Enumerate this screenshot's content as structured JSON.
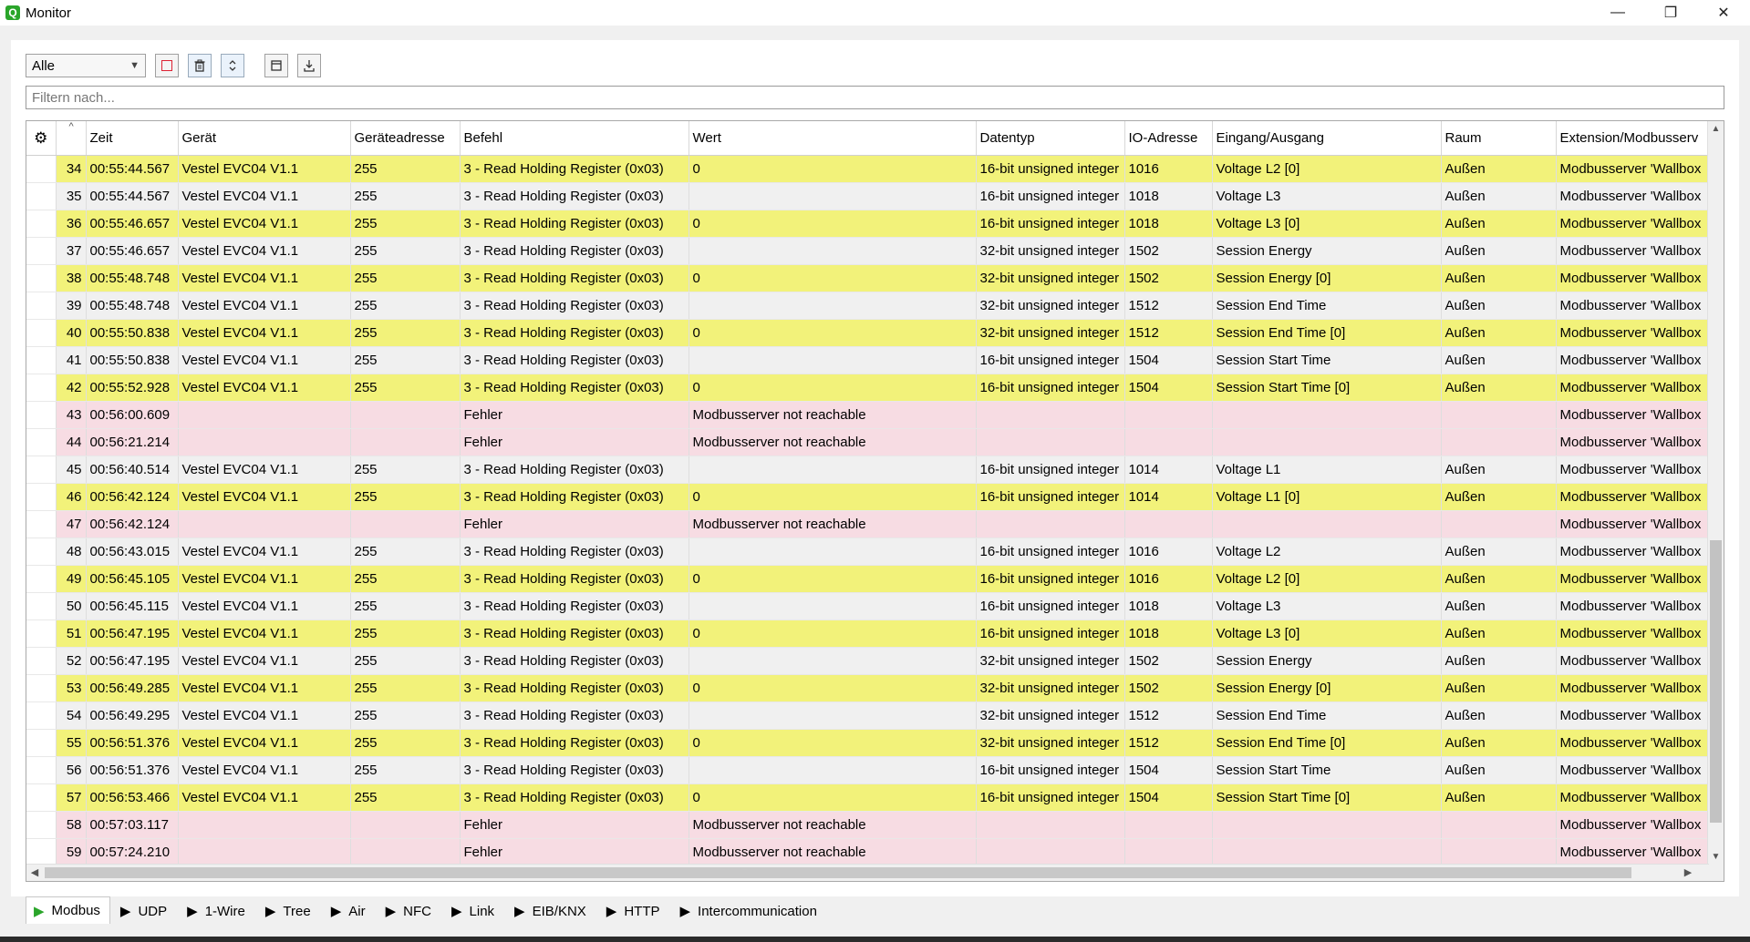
{
  "window": {
    "title": "Monitor",
    "icon": "app-logo-icon"
  },
  "toolbar": {
    "filter_select": "Alle",
    "buttons": [
      "stop-icon",
      "trash-icon",
      "autoscroll-icon",
      "copy-icon",
      "download-icon"
    ]
  },
  "filter": {
    "placeholder": "Filtern nach..."
  },
  "table": {
    "columns": [
      "Zeit",
      "Gerät",
      "Geräteadresse",
      "Befehl",
      "Wert",
      "Datentyp",
      "IO-Adresse",
      "Eingang/Ausgang",
      "Raum",
      "Extension/Modbusserv"
    ],
    "rows": [
      {
        "n": "34",
        "time": "00:55:44.567",
        "dev": "Vestel EVC04 V1.1",
        "addr": "255",
        "cmd": "3 - Read Holding Register (0x03)",
        "val": "0",
        "type": "16-bit unsigned integer",
        "io": "1016",
        "ea": "Voltage L2 [0]",
        "room": "Außen",
        "ext": "Modbusserver 'Wallbox",
        "kind": "yellow"
      },
      {
        "n": "35",
        "time": "00:55:44.567",
        "dev": "Vestel EVC04 V1.1",
        "addr": "255",
        "cmd": "3 - Read Holding Register (0x03)",
        "val": "",
        "type": "16-bit unsigned integer",
        "io": "1018",
        "ea": "Voltage L3",
        "room": "Außen",
        "ext": "Modbusserver 'Wallbox",
        "kind": "data"
      },
      {
        "n": "36",
        "time": "00:55:46.657",
        "dev": "Vestel EVC04 V1.1",
        "addr": "255",
        "cmd": "3 - Read Holding Register (0x03)",
        "val": "0",
        "type": "16-bit unsigned integer",
        "io": "1018",
        "ea": "Voltage L3 [0]",
        "room": "Außen",
        "ext": "Modbusserver 'Wallbox",
        "kind": "yellow"
      },
      {
        "n": "37",
        "time": "00:55:46.657",
        "dev": "Vestel EVC04 V1.1",
        "addr": "255",
        "cmd": "3 - Read Holding Register (0x03)",
        "val": "",
        "type": "32-bit unsigned integer",
        "io": "1502",
        "ea": "Session Energy",
        "room": "Außen",
        "ext": "Modbusserver 'Wallbox",
        "kind": "data"
      },
      {
        "n": "38",
        "time": "00:55:48.748",
        "dev": "Vestel EVC04 V1.1",
        "addr": "255",
        "cmd": "3 - Read Holding Register (0x03)",
        "val": "0",
        "type": "32-bit unsigned integer",
        "io": "1502",
        "ea": "Session Energy [0]",
        "room": "Außen",
        "ext": "Modbusserver 'Wallbox",
        "kind": "yellow"
      },
      {
        "n": "39",
        "time": "00:55:48.748",
        "dev": "Vestel EVC04 V1.1",
        "addr": "255",
        "cmd": "3 - Read Holding Register (0x03)",
        "val": "",
        "type": "32-bit unsigned integer",
        "io": "1512",
        "ea": "Session End Time",
        "room": "Außen",
        "ext": "Modbusserver 'Wallbox",
        "kind": "data"
      },
      {
        "n": "40",
        "time": "00:55:50.838",
        "dev": "Vestel EVC04 V1.1",
        "addr": "255",
        "cmd": "3 - Read Holding Register (0x03)",
        "val": "0",
        "type": "32-bit unsigned integer",
        "io": "1512",
        "ea": "Session End Time [0]",
        "room": "Außen",
        "ext": "Modbusserver 'Wallbox",
        "kind": "yellow"
      },
      {
        "n": "41",
        "time": "00:55:50.838",
        "dev": "Vestel EVC04 V1.1",
        "addr": "255",
        "cmd": "3 - Read Holding Register (0x03)",
        "val": "",
        "type": "16-bit unsigned integer",
        "io": "1504",
        "ea": "Session Start Time",
        "room": "Außen",
        "ext": "Modbusserver 'Wallbox",
        "kind": "data"
      },
      {
        "n": "42",
        "time": "00:55:52.928",
        "dev": "Vestel EVC04 V1.1",
        "addr": "255",
        "cmd": "3 - Read Holding Register (0x03)",
        "val": "0",
        "type": "16-bit unsigned integer",
        "io": "1504",
        "ea": "Session Start Time [0]",
        "room": "Außen",
        "ext": "Modbusserver 'Wallbox",
        "kind": "yellow"
      },
      {
        "n": "43",
        "time": "00:56:00.609",
        "dev": "",
        "addr": "",
        "cmd": "Fehler",
        "val": "Modbusserver not reachable",
        "type": "",
        "io": "",
        "ea": "",
        "room": "",
        "ext": "Modbusserver 'Wallbox",
        "kind": "error"
      },
      {
        "n": "44",
        "time": "00:56:21.214",
        "dev": "",
        "addr": "",
        "cmd": "Fehler",
        "val": "Modbusserver not reachable",
        "type": "",
        "io": "",
        "ea": "",
        "room": "",
        "ext": "Modbusserver 'Wallbox",
        "kind": "error"
      },
      {
        "n": "45",
        "time": "00:56:40.514",
        "dev": "Vestel EVC04 V1.1",
        "addr": "255",
        "cmd": "3 - Read Holding Register (0x03)",
        "val": "",
        "type": "16-bit unsigned integer",
        "io": "1014",
        "ea": "Voltage L1",
        "room": "Außen",
        "ext": "Modbusserver 'Wallbox",
        "kind": "data"
      },
      {
        "n": "46",
        "time": "00:56:42.124",
        "dev": "Vestel EVC04 V1.1",
        "addr": "255",
        "cmd": "3 - Read Holding Register (0x03)",
        "val": "0",
        "type": "16-bit unsigned integer",
        "io": "1014",
        "ea": "Voltage L1 [0]",
        "room": "Außen",
        "ext": "Modbusserver 'Wallbox",
        "kind": "yellow"
      },
      {
        "n": "47",
        "time": "00:56:42.124",
        "dev": "",
        "addr": "",
        "cmd": "Fehler",
        "val": "Modbusserver not reachable",
        "type": "",
        "io": "",
        "ea": "",
        "room": "",
        "ext": "Modbusserver 'Wallbox",
        "kind": "error"
      },
      {
        "n": "48",
        "time": "00:56:43.015",
        "dev": "Vestel EVC04 V1.1",
        "addr": "255",
        "cmd": "3 - Read Holding Register (0x03)",
        "val": "",
        "type": "16-bit unsigned integer",
        "io": "1016",
        "ea": "Voltage L2",
        "room": "Außen",
        "ext": "Modbusserver 'Wallbox",
        "kind": "data"
      },
      {
        "n": "49",
        "time": "00:56:45.105",
        "dev": "Vestel EVC04 V1.1",
        "addr": "255",
        "cmd": "3 - Read Holding Register (0x03)",
        "val": "0",
        "type": "16-bit unsigned integer",
        "io": "1016",
        "ea": "Voltage L2 [0]",
        "room": "Außen",
        "ext": "Modbusserver 'Wallbox",
        "kind": "yellow"
      },
      {
        "n": "50",
        "time": "00:56:45.115",
        "dev": "Vestel EVC04 V1.1",
        "addr": "255",
        "cmd": "3 - Read Holding Register (0x03)",
        "val": "",
        "type": "16-bit unsigned integer",
        "io": "1018",
        "ea": "Voltage L3",
        "room": "Außen",
        "ext": "Modbusserver 'Wallbox",
        "kind": "data"
      },
      {
        "n": "51",
        "time": "00:56:47.195",
        "dev": "Vestel EVC04 V1.1",
        "addr": "255",
        "cmd": "3 - Read Holding Register (0x03)",
        "val": "0",
        "type": "16-bit unsigned integer",
        "io": "1018",
        "ea": "Voltage L3 [0]",
        "room": "Außen",
        "ext": "Modbusserver 'Wallbox",
        "kind": "yellow"
      },
      {
        "n": "52",
        "time": "00:56:47.195",
        "dev": "Vestel EVC04 V1.1",
        "addr": "255",
        "cmd": "3 - Read Holding Register (0x03)",
        "val": "",
        "type": "32-bit unsigned integer",
        "io": "1502",
        "ea": "Session Energy",
        "room": "Außen",
        "ext": "Modbusserver 'Wallbox",
        "kind": "data"
      },
      {
        "n": "53",
        "time": "00:56:49.285",
        "dev": "Vestel EVC04 V1.1",
        "addr": "255",
        "cmd": "3 - Read Holding Register (0x03)",
        "val": "0",
        "type": "32-bit unsigned integer",
        "io": "1502",
        "ea": "Session Energy [0]",
        "room": "Außen",
        "ext": "Modbusserver 'Wallbox",
        "kind": "yellow"
      },
      {
        "n": "54",
        "time": "00:56:49.295",
        "dev": "Vestel EVC04 V1.1",
        "addr": "255",
        "cmd": "3 - Read Holding Register (0x03)",
        "val": "",
        "type": "32-bit unsigned integer",
        "io": "1512",
        "ea": "Session End Time",
        "room": "Außen",
        "ext": "Modbusserver 'Wallbox",
        "kind": "data"
      },
      {
        "n": "55",
        "time": "00:56:51.376",
        "dev": "Vestel EVC04 V1.1",
        "addr": "255",
        "cmd": "3 - Read Holding Register (0x03)",
        "val": "0",
        "type": "32-bit unsigned integer",
        "io": "1512",
        "ea": "Session End Time [0]",
        "room": "Außen",
        "ext": "Modbusserver 'Wallbox",
        "kind": "yellow"
      },
      {
        "n": "56",
        "time": "00:56:51.376",
        "dev": "Vestel EVC04 V1.1",
        "addr": "255",
        "cmd": "3 - Read Holding Register (0x03)",
        "val": "",
        "type": "16-bit unsigned integer",
        "io": "1504",
        "ea": "Session Start Time",
        "room": "Außen",
        "ext": "Modbusserver 'Wallbox",
        "kind": "data"
      },
      {
        "n": "57",
        "time": "00:56:53.466",
        "dev": "Vestel EVC04 V1.1",
        "addr": "255",
        "cmd": "3 - Read Holding Register (0x03)",
        "val": "0",
        "type": "16-bit unsigned integer",
        "io": "1504",
        "ea": "Session Start Time [0]",
        "room": "Außen",
        "ext": "Modbusserver 'Wallbox",
        "kind": "yellow"
      },
      {
        "n": "58",
        "time": "00:57:03.117",
        "dev": "",
        "addr": "",
        "cmd": "Fehler",
        "val": "Modbusserver not reachable",
        "type": "",
        "io": "",
        "ea": "",
        "room": "",
        "ext": "Modbusserver 'Wallbox",
        "kind": "error"
      },
      {
        "n": "59",
        "time": "00:57:24.210",
        "dev": "",
        "addr": "",
        "cmd": "Fehler",
        "val": "Modbusserver not reachable",
        "type": "",
        "io": "",
        "ea": "",
        "room": "",
        "ext": "Modbusserver 'Wallbox",
        "kind": "error"
      }
    ]
  },
  "tabs": [
    {
      "label": "Modbus",
      "active": true
    },
    {
      "label": "UDP",
      "active": false
    },
    {
      "label": "1-Wire",
      "active": false
    },
    {
      "label": "Tree",
      "active": false
    },
    {
      "label": "Air",
      "active": false
    },
    {
      "label": "NFC",
      "active": false
    },
    {
      "label": "Link",
      "active": false
    },
    {
      "label": "EIB/KNX",
      "active": false
    },
    {
      "label": "HTTP",
      "active": false
    },
    {
      "label": "Intercommunication",
      "active": false
    }
  ],
  "colors": {
    "row_yellow": "#f2f27a",
    "row_error": "#f7dce3",
    "row_data": "#f0f0f0",
    "accent_green": "#2aa52a"
  }
}
